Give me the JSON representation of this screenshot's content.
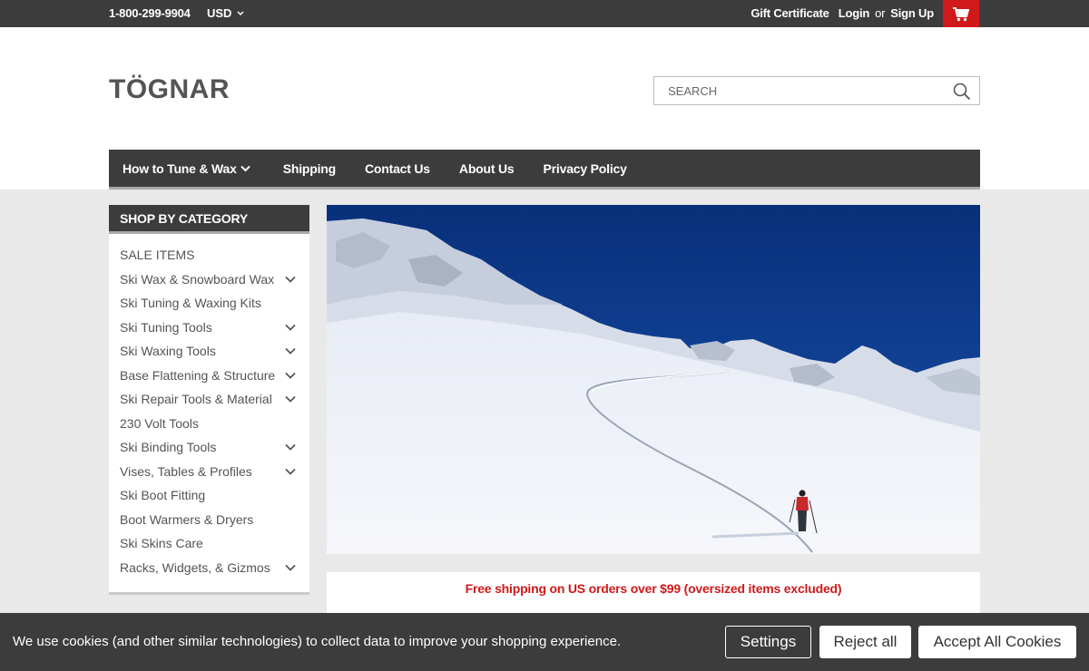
{
  "topbar": {
    "phone": "1-800-299-9904",
    "currency": "USD",
    "gift_certificate": "Gift Certificate",
    "login": "Login",
    "or": "or",
    "sign_up": "Sign Up"
  },
  "header": {
    "logo": "TÖGNAR",
    "search_placeholder": "SEARCH"
  },
  "nav": {
    "items": [
      {
        "label": "How to Tune & Wax"
      },
      {
        "label": "Shipping"
      },
      {
        "label": "Contact Us"
      },
      {
        "label": "About Us"
      },
      {
        "label": "Privacy Policy"
      }
    ]
  },
  "sidebar": {
    "heading": "SHOP BY CATEGORY",
    "categories": [
      {
        "label": "SALE ITEMS",
        "expandable": false
      },
      {
        "label": "Ski Wax & Snowboard Wax",
        "expandable": true
      },
      {
        "label": "Ski Tuning & Waxing Kits",
        "expandable": false
      },
      {
        "label": "Ski Tuning Tools",
        "expandable": true
      },
      {
        "label": "Ski Waxing Tools",
        "expandable": true
      },
      {
        "label": "Base Flattening & Structure",
        "expandable": true
      },
      {
        "label": "Ski Repair Tools & Material",
        "expandable": true
      },
      {
        "label": "230 Volt Tools",
        "expandable": false
      },
      {
        "label": "Ski Binding Tools",
        "expandable": true
      },
      {
        "label": "Vises, Tables & Profiles",
        "expandable": true
      },
      {
        "label": "Ski Boot Fitting",
        "expandable": false
      },
      {
        "label": "Boot Warmers & Dryers",
        "expandable": false
      },
      {
        "label": "Ski Skins Care",
        "expandable": false
      },
      {
        "label": "Racks, Widgets, & Gizmos",
        "expandable": true
      }
    ]
  },
  "promo": {
    "shipping_text": "Free shipping on US orders over $99 (oversized items excluded)"
  },
  "cookie_banner": {
    "message": "We use cookies (and other similar technologies) to collect data to improve your shopping experience.",
    "settings_label": "Settings",
    "reject_label": "Reject all",
    "accept_label": "Accept All Cookies"
  },
  "colors": {
    "dark": "#3c3c3c",
    "accent_red": "#d0191a",
    "sky": "#0a3a8a"
  }
}
